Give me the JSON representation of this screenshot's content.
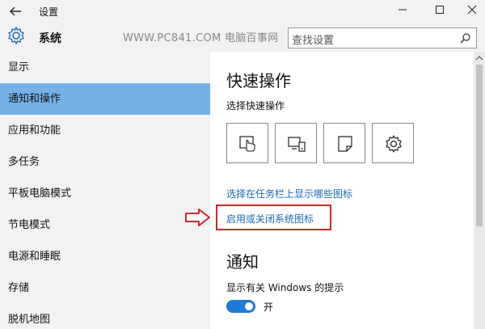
{
  "window": {
    "title": "设置"
  },
  "header": {
    "section_title": "系统",
    "watermark": "WWW.PC841.COM 电脑百事网",
    "search_placeholder": "查找设置"
  },
  "sidebar": {
    "items": [
      {
        "label": "显示"
      },
      {
        "label": "通知和操作",
        "active": true
      },
      {
        "label": "应用和功能"
      },
      {
        "label": "多任务"
      },
      {
        "label": "平板电脑模式"
      },
      {
        "label": "节电模式"
      },
      {
        "label": "电源和睡眠"
      },
      {
        "label": "存储"
      },
      {
        "label": "脱机地图"
      }
    ]
  },
  "main": {
    "quick_title": "快速操作",
    "quick_subtitle": "选择快速操作",
    "quick_actions": [
      {
        "icon": "tablet-mode-icon"
      },
      {
        "icon": "connect-icon"
      },
      {
        "icon": "note-icon"
      },
      {
        "icon": "settings-icon"
      }
    ],
    "link_taskbar_icons": "选择在任务栏上显示哪些图标",
    "link_system_icons": "启用或关闭系统图标",
    "notify_title": "通知",
    "notify_windows_tips": "显示有关 Windows 的提示",
    "toggle_state": "开"
  },
  "colors": {
    "active_item": "#75b1e7",
    "link": "#1a6ab6",
    "highlight": "#d0262a",
    "toggle_on": "#1f7ad4"
  }
}
